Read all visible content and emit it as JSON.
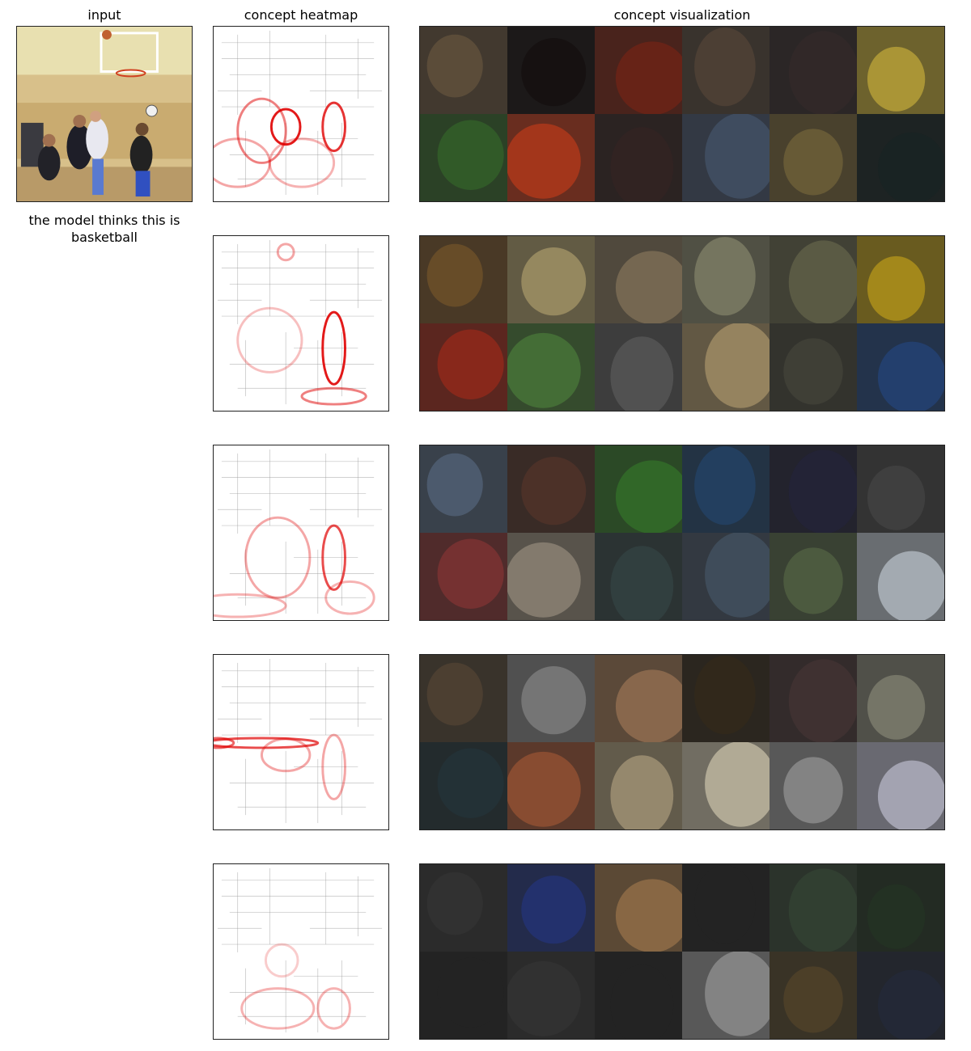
{
  "titles": {
    "input": "input",
    "heatmap": "concept heatmap",
    "visualization": "concept visualization"
  },
  "caption": "the model thinks this is basketball",
  "rows": [
    {
      "heat_focus": "players",
      "tiles": [
        "#6b5a44",
        "#1a1414",
        "#7a2a1c",
        "#5a4a3e",
        "#3a3030",
        "#c8b040",
        "#3a6a30",
        "#c04020",
        "#3a2a28",
        "#4a5a70",
        "#7a6a40",
        "#1e2a2a"
      ]
    },
    {
      "heat_focus": "right-player",
      "tiles": [
        "#7a5a30",
        "#b0a070",
        "#8a7a60",
        "#8a8a70",
        "#6a6a50",
        "#c0a020",
        "#a03020",
        "#508040",
        "#606060",
        "#b09a70",
        "#4a4a40",
        "#2a4a80"
      ]
    },
    {
      "heat_focus": "lower",
      "tiles": [
        "#5a6a80",
        "#5a3a30",
        "#3a7a30",
        "#2a4a70",
        "#2a2a40",
        "#4a4a4a",
        "#8a3a3a",
        "#9a9080",
        "#3a4a4a",
        "#4a5a6a",
        "#5a6a4a",
        "#c0c8d0"
      ]
    },
    {
      "heat_focus": "horizontal",
      "tiles": [
        "#5a4a3a",
        "#8a8a8a",
        "#a07a5a",
        "#3a3020",
        "#4a3a3a",
        "#8a8a7a",
        "#2a3a40",
        "#a05a3a",
        "#b0a080",
        "#d0c8b0",
        "#9a9a9a",
        "#c0c0d0"
      ]
    },
    {
      "heat_focus": "legs",
      "tiles": [
        "#3a3a3a",
        "#2a3a80",
        "#a07a50",
        "#2a2a2a",
        "#3a4a3a",
        "#2a3a2a",
        "#2a2a2a",
        "#3a3a3a",
        "#2a2a2a",
        "#9a9a9a",
        "#5a4a30",
        "#2a3040"
      ]
    }
  ],
  "colors": {
    "frame": "#222222",
    "heat": "#e00000",
    "edges": "#9a9a9a"
  }
}
